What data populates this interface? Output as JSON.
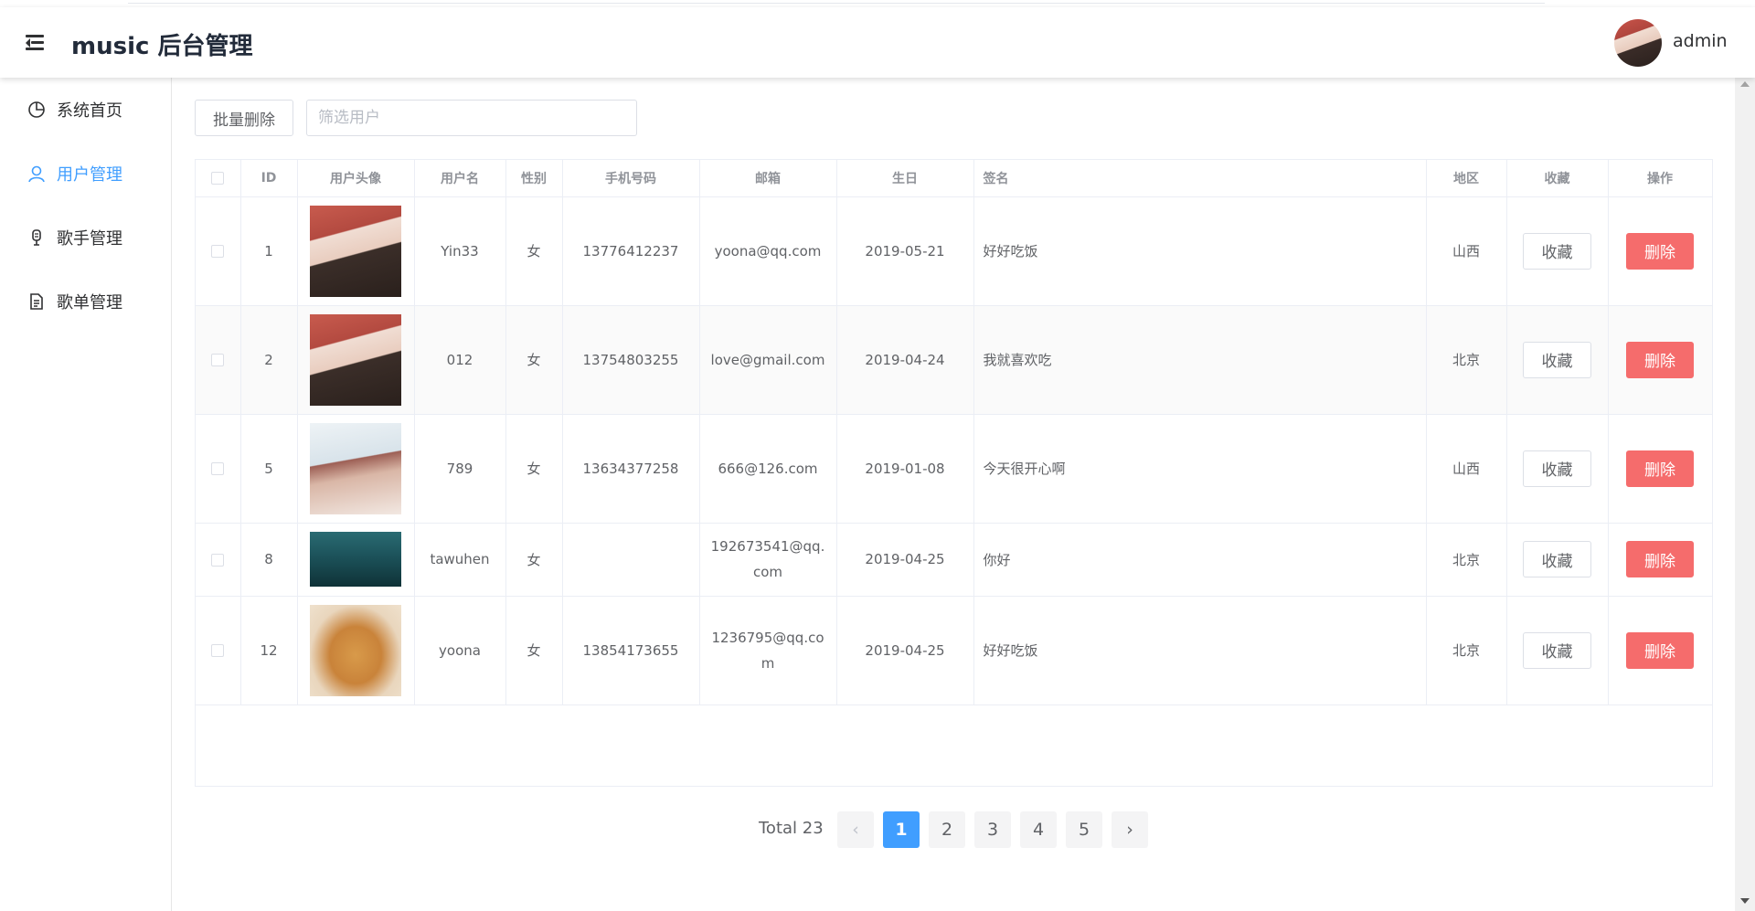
{
  "header": {
    "title": "music 后台管理",
    "user_name": "admin"
  },
  "sidebar": {
    "items": [
      {
        "label": "系统首页",
        "icon": "pie-chart-icon",
        "active": false
      },
      {
        "label": "用户管理",
        "icon": "user-icon",
        "active": true
      },
      {
        "label": "歌手管理",
        "icon": "microphone-icon",
        "active": false
      },
      {
        "label": "歌单管理",
        "icon": "document-icon",
        "active": false
      }
    ]
  },
  "toolbar": {
    "batch_delete_label": "批量删除",
    "search_placeholder": "筛选用户"
  },
  "table": {
    "columns": [
      "ID",
      "用户头像",
      "用户名",
      "性别",
      "手机号码",
      "邮箱",
      "生日",
      "签名",
      "地区",
      "收藏",
      "操作"
    ],
    "rows": [
      {
        "id": "1",
        "avatar": "girl-red-hat",
        "username": "Yin33",
        "gender": "女",
        "phone": "13776412237",
        "email": "yoona@qq.com",
        "birthday": "2019-05-21",
        "signature": "好好吃饭",
        "region": "山西"
      },
      {
        "id": "2",
        "avatar": "girl-red-hat",
        "username": "012",
        "gender": "女",
        "phone": "13754803255",
        "email": "love@gmail.com",
        "birthday": "2019-04-24",
        "signature": "我就喜欢吃",
        "region": "北京"
      },
      {
        "id": "5",
        "avatar": "girl-smiling-beach",
        "username": "789",
        "gender": "女",
        "phone": "13634377258",
        "email": "666@126.com",
        "birthday": "2019-01-08",
        "signature": "今天很开心啊",
        "region": "山西"
      },
      {
        "id": "8",
        "avatar": "underwater-scene",
        "username": "tawuhen",
        "gender": "女",
        "phone": "",
        "email": "192673541@qq.com",
        "birthday": "2019-04-25",
        "signature": "你好",
        "region": "北京"
      },
      {
        "id": "12",
        "avatar": "orange-cat",
        "username": "yoona",
        "gender": "女",
        "phone": "13854173655",
        "email": "1236795@qq.com",
        "birthday": "2019-04-25",
        "signature": "好好吃饭",
        "region": "北京"
      }
    ],
    "fav_label": "收藏",
    "delete_label": "删除"
  },
  "pagination": {
    "total_label": "Total 23",
    "pages": [
      "1",
      "2",
      "3",
      "4",
      "5"
    ],
    "current": "1",
    "prev": "‹",
    "next": "›"
  },
  "colors": {
    "accent": "#409eff",
    "danger": "#f56c6c"
  }
}
